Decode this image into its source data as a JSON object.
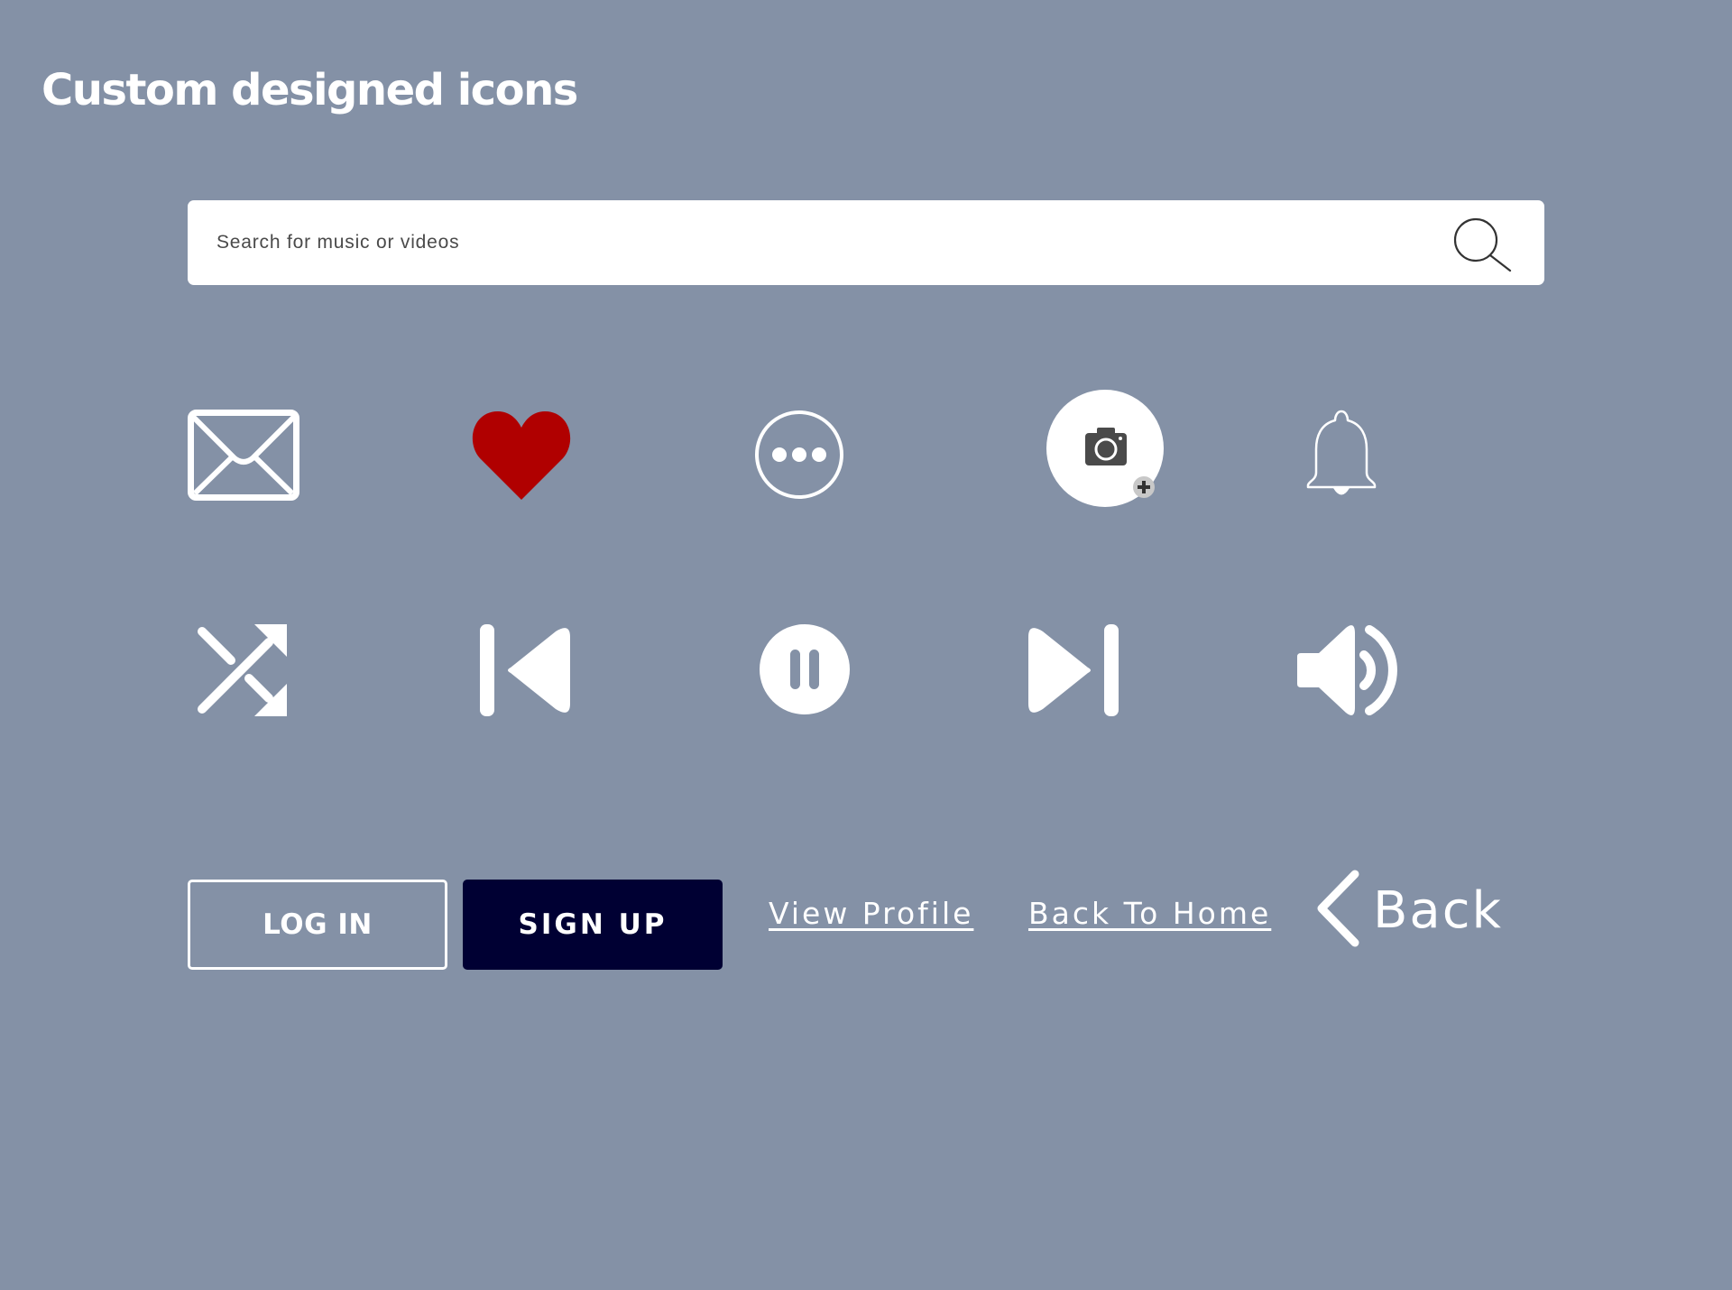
{
  "page": {
    "title": "Custom designed icons"
  },
  "search": {
    "placeholder": "Search for music or videos",
    "icon": "search-icon"
  },
  "icons": {
    "row1": [
      "mail-icon",
      "heart-icon",
      "more-options-icon",
      "add-photo-icon",
      "bell-icon"
    ],
    "row2": [
      "shuffle-icon",
      "skip-previous-icon",
      "pause-icon",
      "skip-next-icon",
      "volume-icon"
    ]
  },
  "buttons": {
    "login_label": "LOG IN",
    "signup_label": "SIGN UP"
  },
  "links": {
    "view_profile": "View Profile",
    "back_to_home": "Back To Home",
    "back": "Back"
  },
  "colors": {
    "background": "#8491a6",
    "heart": "#b00000",
    "signup_button": "#000033",
    "foreground": "#ffffff",
    "camera": "#4a4a4a"
  }
}
